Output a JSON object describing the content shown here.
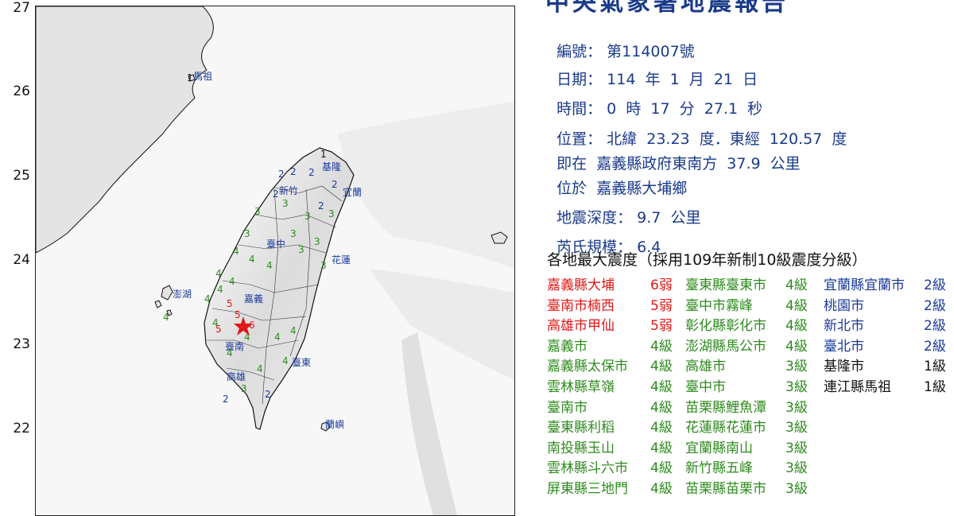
{
  "report": {
    "title": "中央氣象署地震報告",
    "number_label": "編號：",
    "number_value": "第114007號",
    "date_label": "日期：",
    "date_value": "114  年  1  月  21  日",
    "time_label": "時間：",
    "time_value": "0  時  17  分  27.1  秒",
    "location_label": "位置：",
    "location_value": "北緯  23.23  度．東經  120.57  度",
    "relative_label": "即在",
    "relative_value": "嘉義縣政府東南方  37.9  公里",
    "located_label": "位於",
    "located_value": "嘉義縣大埔鄉",
    "depth_label": "地震深度：",
    "depth_value": "9.7  公里",
    "magnitude_label": "芮氏規模：",
    "magnitude_value": "6.4",
    "intensity_heading": "各地最大震度（採用109年新制10級震度分級）"
  },
  "intensity_columns": [
    [
      {
        "name": "嘉義縣大埔",
        "level": "6弱",
        "color": "#e01818"
      },
      {
        "name": "臺南市楠西",
        "level": "5弱",
        "color": "#e01818"
      },
      {
        "name": "高雄市甲仙",
        "level": "5弱",
        "color": "#e01818"
      },
      {
        "name": "嘉義市",
        "level": "4級",
        "color": "#2e8b1e"
      },
      {
        "name": "嘉義縣太保市",
        "level": "4級",
        "color": "#2e8b1e"
      },
      {
        "name": "雲林縣草嶺",
        "level": "4級",
        "color": "#2e8b1e"
      },
      {
        "name": "臺南市",
        "level": "4級",
        "color": "#2e8b1e"
      },
      {
        "name": "臺東縣利稻",
        "level": "4級",
        "color": "#2e8b1e"
      },
      {
        "name": "南投縣玉山",
        "level": "4級",
        "color": "#2e8b1e"
      },
      {
        "name": "雲林縣斗六市",
        "level": "4級",
        "color": "#2e8b1e"
      },
      {
        "name": "屏東縣三地門",
        "level": "4級",
        "color": "#2e8b1e"
      }
    ],
    [
      {
        "name": "臺東縣臺東市",
        "level": "4級",
        "color": "#2e8b1e"
      },
      {
        "name": "臺中市霧峰",
        "level": "4級",
        "color": "#2e8b1e"
      },
      {
        "name": "彰化縣彰化市",
        "level": "4級",
        "color": "#2e8b1e"
      },
      {
        "name": "澎湖縣馬公市",
        "level": "4級",
        "color": "#2e8b1e"
      },
      {
        "name": "高雄市",
        "level": "3級",
        "color": "#2e8b1e"
      },
      {
        "name": "臺中市",
        "level": "3級",
        "color": "#2e8b1e"
      },
      {
        "name": "苗栗縣鯉魚潭",
        "level": "3級",
        "color": "#2e8b1e"
      },
      {
        "name": "花蓮縣花蓮市",
        "level": "3級",
        "color": "#2e8b1e"
      },
      {
        "name": "宜蘭縣南山",
        "level": "3級",
        "color": "#2e8b1e"
      },
      {
        "name": "新竹縣五峰",
        "level": "3級",
        "color": "#2e8b1e"
      },
      {
        "name": "苗栗縣苗栗市",
        "level": "3級",
        "color": "#2e8b1e"
      }
    ],
    [
      {
        "name": "宜蘭縣宜蘭市",
        "level": "2級",
        "color": "#1a3a9a"
      },
      {
        "name": "桃園市",
        "level": "2級",
        "color": "#1a3a9a"
      },
      {
        "name": "新北市",
        "level": "2級",
        "color": "#1a3a9a"
      },
      {
        "name": "臺北市",
        "level": "2級",
        "color": "#1a3a9a"
      },
      {
        "name": "基隆市",
        "level": "1級",
        "color": "#111111"
      },
      {
        "name": "連江縣馬祖",
        "level": "1級",
        "color": "#111111"
      }
    ]
  ],
  "map": {
    "lat_ticks": [
      "27",
      "26",
      "25",
      "24",
      "23",
      "22"
    ],
    "place_labels": [
      "馬祖",
      "基隆",
      "新竹",
      "宜蘭",
      "臺中",
      "花蓮",
      "澎湖",
      "嘉義",
      "臺南",
      "臺東",
      "高雄",
      "蘭嶼"
    ],
    "station_values": {
      "level_1": "1",
      "level_2": "2",
      "level_3": "3",
      "level_4": "4",
      "level_5": "5",
      "level_6": "6"
    },
    "colors": {
      "land": "#e9e9e9",
      "sea": "#f6f6f6",
      "coast": "#111111",
      "epicenter": "#e01818"
    }
  }
}
